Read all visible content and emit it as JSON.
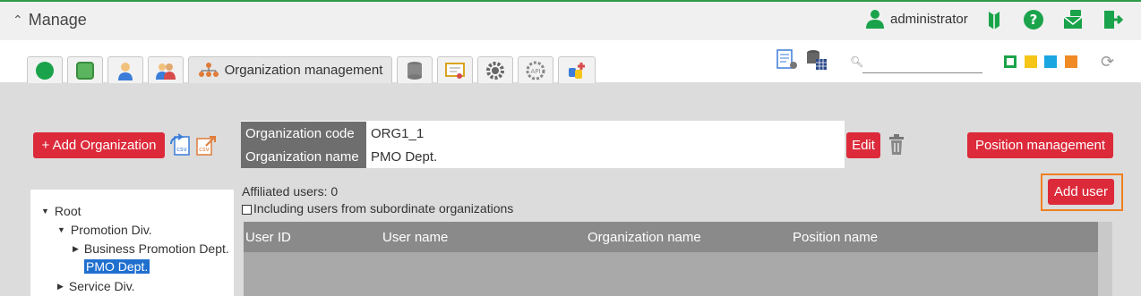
{
  "header": {
    "title": "Manage",
    "username": "administrator"
  },
  "tabs": [
    {
      "icon": "app-icon"
    },
    {
      "icon": "app-window-icon"
    },
    {
      "icon": "user-icon"
    },
    {
      "icon": "users-icon"
    },
    {
      "icon": "organization-icon",
      "label": "Organization management"
    },
    {
      "icon": "database-icon"
    },
    {
      "icon": "certificate-icon"
    },
    {
      "icon": "gear-icon"
    },
    {
      "icon": "api-icon"
    },
    {
      "icon": "plugin-icon"
    }
  ],
  "toolbar": {
    "search_placeholder": "",
    "theme_colors": [
      "#1aa34a",
      "#f5c518",
      "#1aa6e0",
      "#f08a24"
    ]
  },
  "actions": {
    "add_organization": "+ Add Organization",
    "edit": "Edit",
    "position_management": "Position management",
    "add_user": "Add user"
  },
  "organization": {
    "code_label": "Organization code",
    "code_value": "ORG1_1",
    "name_label": "Organization name",
    "name_value": "PMO Dept."
  },
  "affiliated_users": "Affiliated users: 0",
  "including_subordinates": "Including users from subordinate organizations",
  "tree": [
    {
      "label": "Root",
      "expanded": true
    },
    {
      "label": "Promotion Div.",
      "expanded": true
    },
    {
      "label": "Business Promotion Dept."
    },
    {
      "label": "PMO Dept.",
      "selected": true
    },
    {
      "label": "Service Div."
    }
  ],
  "grid_columns": [
    "User ID",
    "User name",
    "Organization name",
    "Position name"
  ]
}
